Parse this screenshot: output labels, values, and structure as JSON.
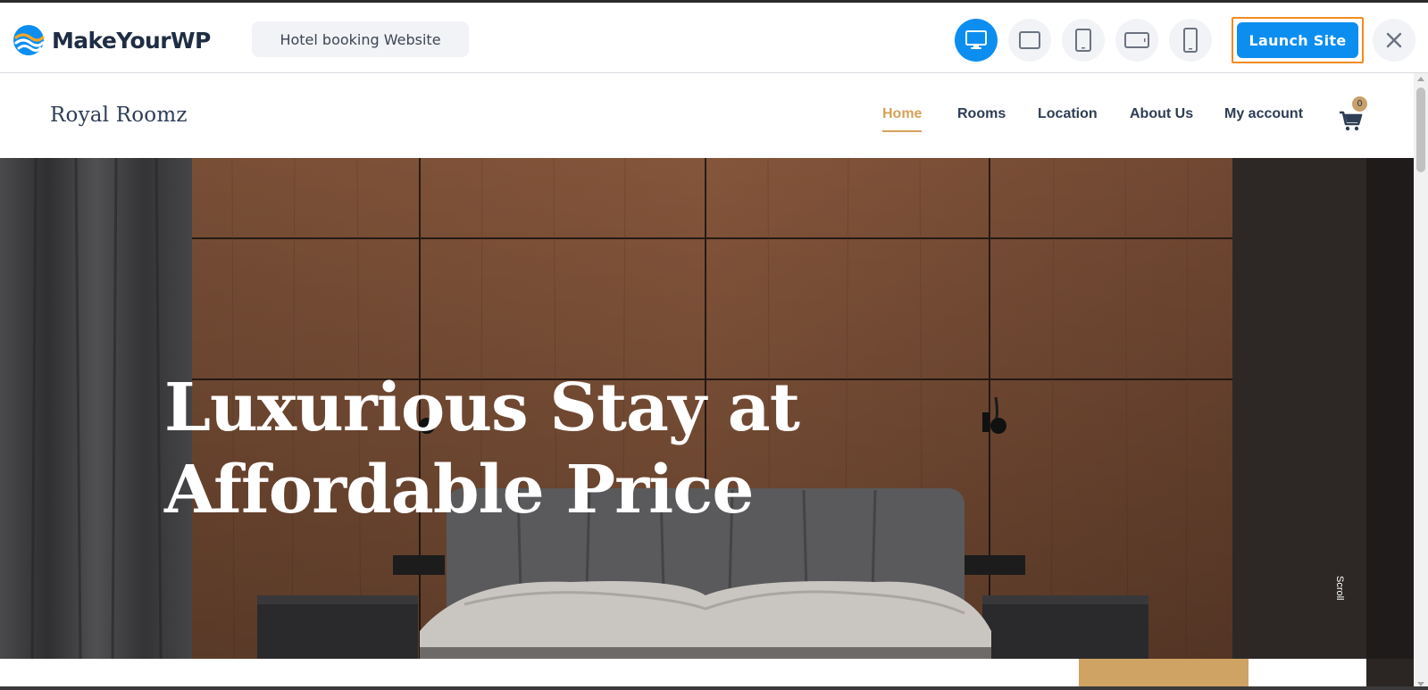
{
  "builder": {
    "brand_name": "MakeYourWP",
    "site_name": "Hotel booking Website",
    "devices": [
      {
        "icon": "desktop-icon",
        "active": true
      },
      {
        "icon": "laptop-icon",
        "active": false
      },
      {
        "icon": "tablet-icon",
        "active": false
      },
      {
        "icon": "tablet-landscape-icon",
        "active": false
      },
      {
        "icon": "mobile-icon",
        "active": false
      }
    ],
    "launch_label": "Launch Site",
    "close_icon": "close-icon",
    "accent_color": "#0c8ef0",
    "highlight_color": "#f28c1f"
  },
  "site": {
    "logo": "Royal Roomz",
    "nav": [
      {
        "label": "Home",
        "active": true
      },
      {
        "label": "Rooms",
        "active": false
      },
      {
        "label": "Location",
        "active": false
      },
      {
        "label": "About Us",
        "active": false
      },
      {
        "label": "My account",
        "active": false
      }
    ],
    "cart_count": "0",
    "cart_icon": "cart-icon",
    "nav_accent_color": "#d4a25c",
    "hero": {
      "title_line1": "Luxurious Stay at",
      "title_line2": "Affordable Price",
      "scroll_label": "Scroll"
    }
  }
}
